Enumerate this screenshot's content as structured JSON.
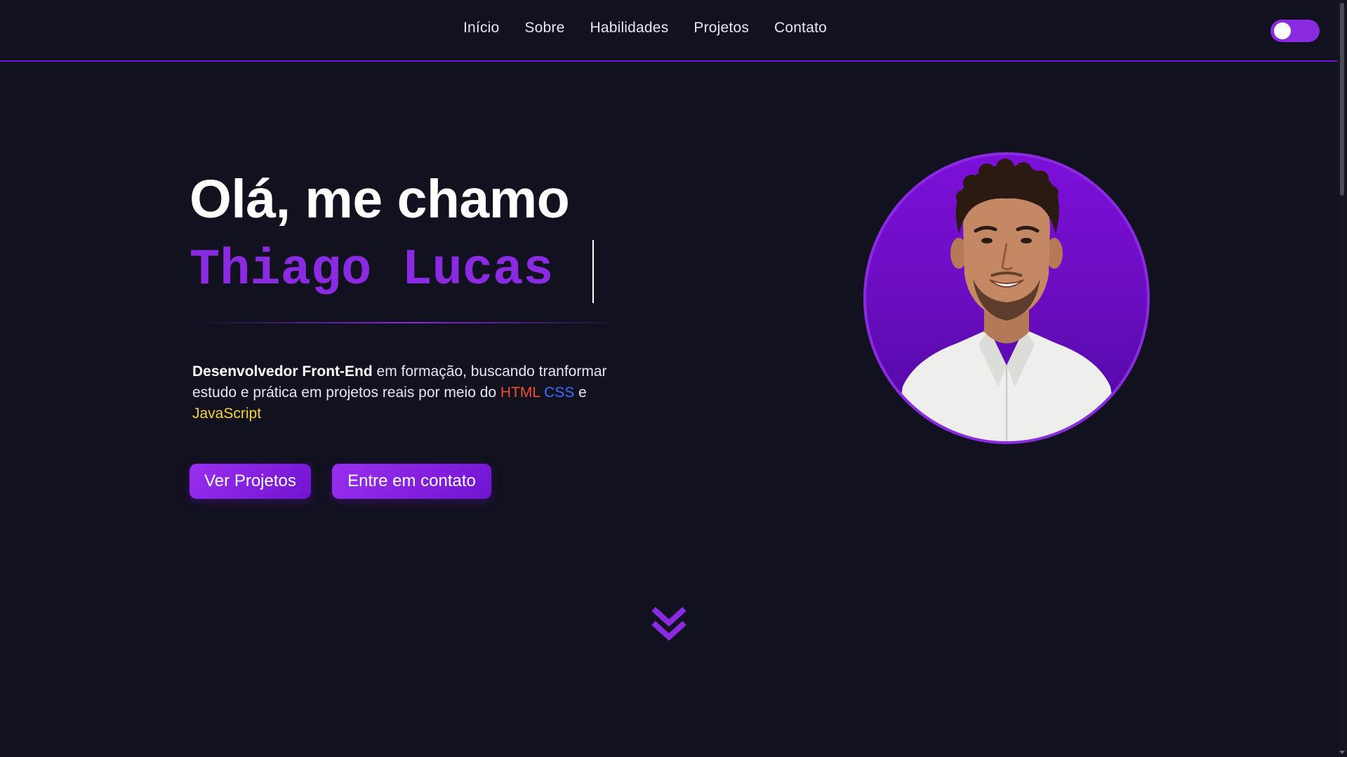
{
  "nav": {
    "links": [
      "Início",
      "Sobre",
      "Habilidades",
      "Projetos",
      "Contato"
    ]
  },
  "hero": {
    "greeting": "Olá, me chamo",
    "name": "Thiago Lucas",
    "bio": {
      "strong": "Desenvolvedor Front-End",
      "text1": " em formação, buscando tranformar estudo e prática em projetos reais por meio do ",
      "html": "HTML",
      "space": " ",
      "css": "CSS",
      "and": " e ",
      "js": "JavaScript"
    },
    "buttons": {
      "projects": "Ver Projetos",
      "contact": "Entre em contato"
    }
  },
  "icons": {
    "scroll_down": "double-chevron-down-icon",
    "theme_toggle": "toggle-switch"
  },
  "colors": {
    "background": "#12111f",
    "accent": "#8a2be2",
    "html": "#f04e2e",
    "css": "#3d6bff",
    "javascript": "#f3d33d"
  }
}
